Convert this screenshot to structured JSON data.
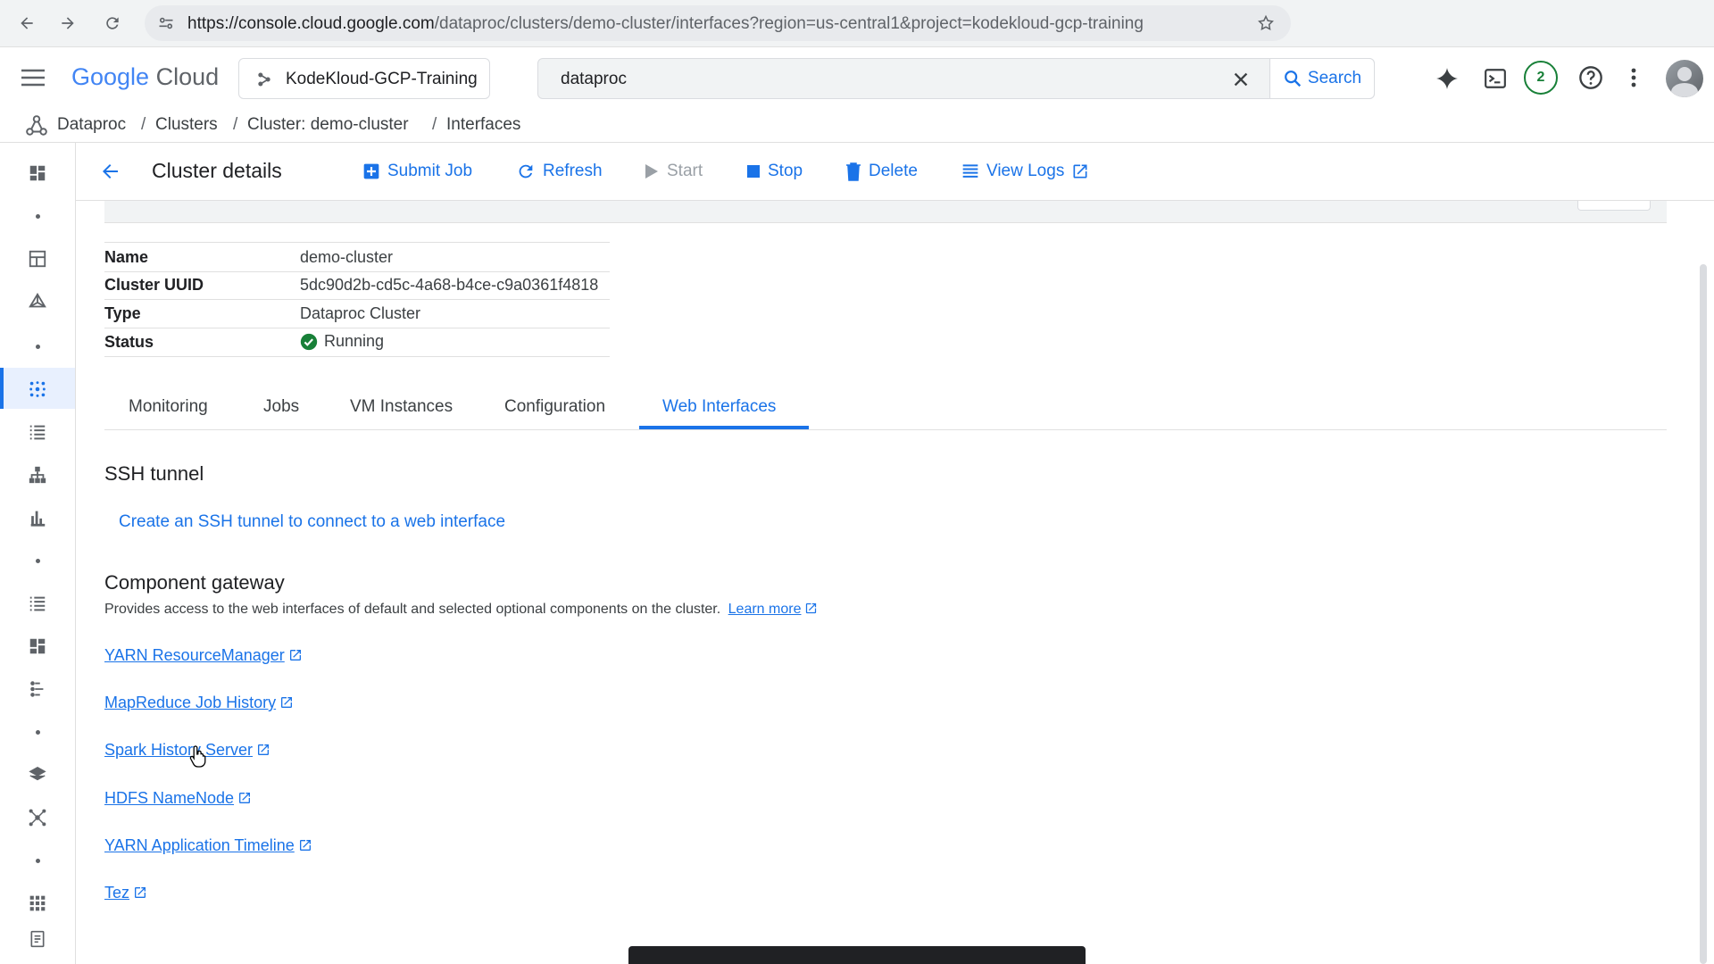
{
  "browser": {
    "url_domain": "https://console.cloud.google.com",
    "url_path": "/dataproc/clusters/demo-cluster/interfaces?region=us-central1&project=kodekloud-gcp-training"
  },
  "header": {
    "logo_google": "Google",
    "logo_cloud": "Cloud",
    "project_name": "KodeKloud-GCP-Training",
    "search_value": "dataproc",
    "search_button": "Search",
    "notification_count": "2"
  },
  "breadcrumb": {
    "items": [
      "Dataproc",
      "Clusters",
      "Cluster: demo-cluster",
      "Interfaces"
    ],
    "separator": "/"
  },
  "toolbar": {
    "title": "Cluster details",
    "submit_job": "Submit Job",
    "refresh": "Refresh",
    "start": "Start",
    "stop": "Stop",
    "delete": "Delete",
    "view_logs": "View Logs"
  },
  "details": {
    "rows": [
      {
        "key": "Name",
        "value": "demo-cluster"
      },
      {
        "key": "Cluster UUID",
        "value": "5dc90d2b-cd5c-4a68-b4ce-c9a0361f4818"
      },
      {
        "key": "Type",
        "value": "Dataproc Cluster"
      },
      {
        "key": "Status",
        "value": "Running"
      }
    ]
  },
  "tabs": [
    "Monitoring",
    "Jobs",
    "VM Instances",
    "Configuration",
    "Web Interfaces"
  ],
  "active_tab": "Web Interfaces",
  "ssh": {
    "heading": "SSH tunnel",
    "link": "Create an SSH tunnel to connect to a web interface"
  },
  "gateway": {
    "heading": "Component gateway",
    "description": "Provides access to the web interfaces of default and selected optional components on the cluster.",
    "learn_more": "Learn more",
    "links": [
      "YARN ResourceManager",
      "MapReduce Job History",
      "Spark History Server",
      "HDFS NameNode",
      "YARN Application Timeline",
      "Tez"
    ]
  },
  "colors": {
    "accent": "#1a73e8",
    "status_ok": "#188038",
    "text": "#202124"
  }
}
